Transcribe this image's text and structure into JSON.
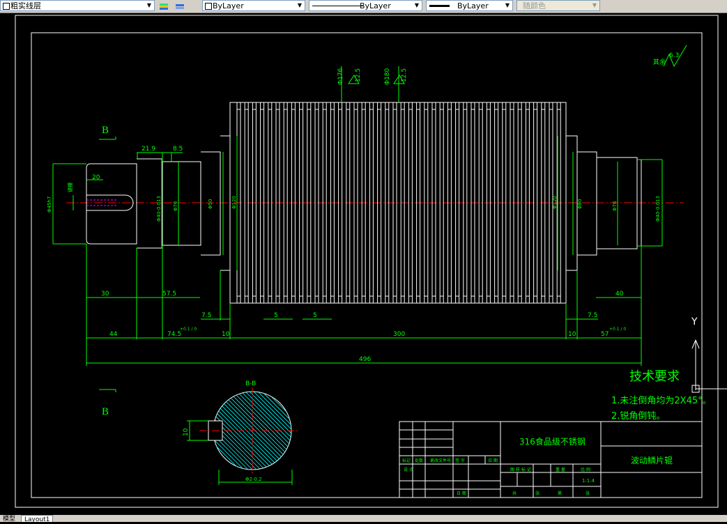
{
  "toolbar": {
    "layer_value": "粗实线层",
    "color_value": "ByLayer",
    "linetype_value": "ByLayer",
    "lineweight_value": "ByLayer",
    "plotstyle_value": "随颜色"
  },
  "drawing": {
    "view_label_b_top": "B",
    "view_label_b_bottom": "B",
    "section_label": "B-B",
    "roughness_note": "其余",
    "roughness_value": "6.3",
    "roughness_top1": "12.5",
    "roughness_top2": "12.5",
    "dims": {
      "d_21_9": "21.9",
      "d_8_5": "8.5",
      "d_20": "20",
      "d_30": "30",
      "d_57_5": "57.5",
      "d_40": "40",
      "d_7_5a": "7.5",
      "d_5a": "5",
      "d_5b": "5",
      "d_7_5b": "7.5",
      "d_44": "44",
      "d_74_5": "74.5",
      "d_74_5_tol": "+0.1 / 0",
      "d_10a": "10",
      "d_300": "300",
      "d_10b": "10",
      "d_57": "57",
      "d_57_tol": "+0.1 / 0",
      "d_496": "496",
      "d_10_key": "10",
      "d_62": "Φ2-0.2",
      "v_key": "键槽",
      "v_phi50_left": "Φ50",
      "v_phi76_left": "Φ76",
      "v_phi120_left": "Φ120",
      "v_phi45_left": "Φ45h7",
      "v_phi40_left": "Φ40-0.013",
      "v_phi120_right": "Φ120",
      "v_phi80_right": "Φ80",
      "v_phi76_right": "Φ76",
      "v_phi40_right": "Φ40-0.013",
      "v_top1": "Φ176",
      "v_top2": "Φ180"
    },
    "tech_title": "技术要求",
    "tech_items": [
      "1.未注倒角均为2X45°。",
      "2.锐角倒钝。"
    ],
    "title_block": {
      "material": "316食品级不锈钢",
      "part_name": "波动鳞片辊",
      "scale": "1:1.4",
      "headers": [
        "标记",
        "处数",
        "更改文件号",
        "签 字",
        "日 期"
      ],
      "row_design": "设 计",
      "row_date": "日 期",
      "labels2": [
        "图 样 标 记",
        "重 量",
        "比 例"
      ],
      "labels3": [
        "共",
        "张",
        "第",
        "张"
      ]
    }
  },
  "tabs": {
    "model": "模型",
    "layout1": "Layout1"
  },
  "colors": {
    "frame": "#ffffff",
    "dim": "#00ff00",
    "center": "#ff0000",
    "hatch": "#00ffff"
  }
}
